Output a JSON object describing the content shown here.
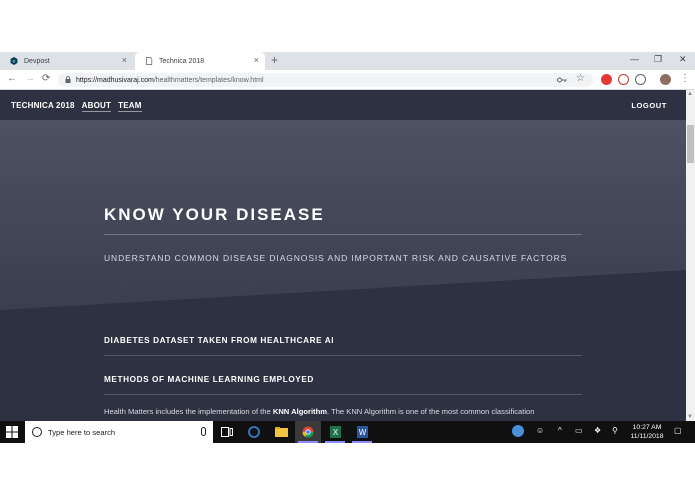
{
  "browser": {
    "tabs": [
      {
        "title": "Devpost",
        "active": false,
        "icon": "devpost-favicon"
      },
      {
        "title": "Technica 2018",
        "active": true,
        "icon": "page-favicon"
      }
    ],
    "new_tab": "+",
    "tab_close": "×",
    "window_controls": {
      "minimize": "—",
      "restore": "❐",
      "close": "✕"
    },
    "nav": {
      "back": "←",
      "forward": "→",
      "reload": "⟳"
    },
    "url_host": "https://madhusivaraj.com",
    "url_path": "/healthmatters/templates/know.html",
    "menu_icon": "⋮",
    "star_icon": "☆"
  },
  "site": {
    "nav_items": [
      "TECHNICA 2018",
      "ABOUT",
      "TEAM"
    ],
    "logout": "LOGOUT",
    "banner_title": "KNOW YOUR DISEASE",
    "banner_subtitle": "UNDERSTAND COMMON DISEASE DIAGNOSIS AND IMPORTANT RISK AND CAUSATIVE FACTORS",
    "sections": [
      "DIABETES DATASET TAKEN FROM HEALTHCARE AI",
      "METHODS OF MACHINE LEARNING EMPLOYED"
    ],
    "para_before": "Health Matters includes the implementation of the ",
    "para_bold": "KNN Algorithm",
    "para_after": ". The KNN Algorithm is one of the most common classification"
  },
  "taskbar": {
    "search_placeholder": "Type here to search",
    "time": "10:27 AM",
    "date": "11/11/2018",
    "tray_up": "^",
    "tray_icons": [
      "network-icon",
      "volume-icon",
      "notification-icon"
    ]
  },
  "colors": {
    "page_bg": "#2e3141",
    "banner_top": "#4d5263",
    "chrome_tabbar": "#dee1e6",
    "taskbar": "#101010"
  }
}
